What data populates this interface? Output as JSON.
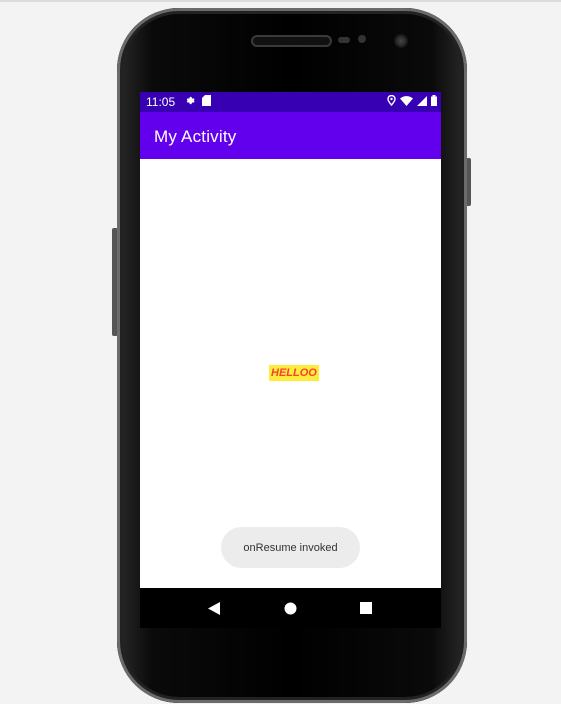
{
  "device": {
    "status_bar": {
      "time": "11:05",
      "left_icons": [
        "gear-icon",
        "sd-card-icon"
      ],
      "right_icons": [
        "location-icon",
        "wifi-icon",
        "signal-icon",
        "battery-icon"
      ]
    },
    "app_bar": {
      "title": "My Activity"
    },
    "content": {
      "text": "HELLOO"
    },
    "toast": {
      "message": "onResume invoked"
    },
    "nav_bar": {
      "buttons": [
        "back-icon",
        "home-icon",
        "recents-icon"
      ]
    }
  },
  "colors": {
    "status_bar": "#3700b3",
    "app_bar": "#6200ee",
    "text_highlight": "#ffeb3b",
    "text_color": "#f44336",
    "page_background": "#f3f3f3"
  }
}
